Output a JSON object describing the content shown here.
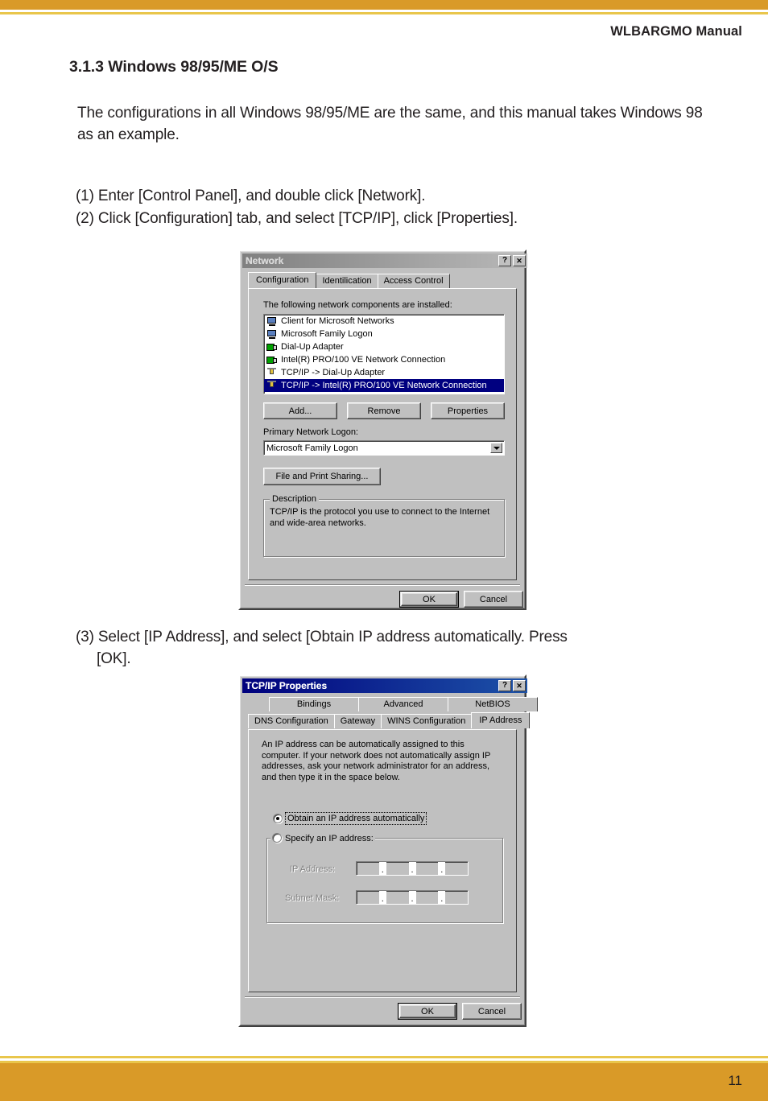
{
  "page": {
    "header_title": "WLBARGMO Manual",
    "page_number": "11",
    "accent_orange": "#d99a28",
    "accent_yellow": "#e9c64c"
  },
  "document": {
    "section_heading": "3.1.3 Windows 98/95/ME O/S",
    "intro_paragraph": "The configurations in all Windows 98/95/ME are the same, and this manual takes Windows 98 as an example.",
    "step1": "(1) Enter [Control Panel], and double click [Network].",
    "step2": "(2) Click [Configuration] tab, and select [TCP/IP], click [Properties].",
    "step3_line1": "(3) Select [IP Address], and select [Obtain IP address automatically. Press",
    "step3_line2": "[OK]."
  },
  "network_dialog": {
    "title": "Network",
    "titlebar_state": "inactive",
    "help_button": "?",
    "close_button": "✕",
    "tabs": [
      {
        "label": "Configuration",
        "selected": true
      },
      {
        "label": "Identilication",
        "selected": false
      },
      {
        "label": "Access Control",
        "selected": false
      }
    ],
    "list_label": "The following network components are installed:",
    "components": [
      {
        "label": "Client for Microsoft Networks",
        "icon": "monitor-icon",
        "selected": false
      },
      {
        "label": "Microsoft Family Logon",
        "icon": "monitor-icon",
        "selected": false
      },
      {
        "label": "Dial-Up Adapter",
        "icon": "network-card-icon",
        "selected": false
      },
      {
        "label": "Intel(R) PRO/100 VE Network Connection",
        "icon": "network-card-icon",
        "selected": false
      },
      {
        "label": "TCP/IP -> Dial-Up Adapter",
        "icon": "protocol-icon",
        "selected": false
      },
      {
        "label": "TCP/IP -> Intel(R) PRO/100 VE Network Connection",
        "icon": "protocol-icon",
        "selected": true
      }
    ],
    "add_button": "Add...",
    "remove_button": "Remove",
    "properties_button": "Properties",
    "primary_logon_label": "Primary Network Logon:",
    "primary_logon_value": "Microsoft Family Logon",
    "file_print_sharing_button": "File and Print Sharing...",
    "description_group_title": "Description",
    "description_text": "TCP/IP is the protocol you use to connect to the Internet and wide-area networks.",
    "ok_button": "OK",
    "cancel_button": "Cancel"
  },
  "tcpip_dialog": {
    "title": "TCP/IP Properties",
    "titlebar_state": "active",
    "help_button": "?",
    "close_button": "✕",
    "tabs_row1": [
      {
        "label": "Bindings",
        "selected": false
      },
      {
        "label": "Advanced",
        "selected": false
      },
      {
        "label": "NetBIOS",
        "selected": false
      }
    ],
    "tabs_row2": [
      {
        "label": "DNS Configuration",
        "selected": false
      },
      {
        "label": "Gateway",
        "selected": false
      },
      {
        "label": "WINS Configuration",
        "selected": false
      },
      {
        "label": "IP Address",
        "selected": true
      }
    ],
    "info_text": "An IP address can be automatically assigned to this computer. If your network does not automatically assign IP addresses, ask your network administrator for an address, and then type it in the space below.",
    "radio_obtain": {
      "label": "Obtain an IP address automatically",
      "selected": true,
      "focused": true
    },
    "radio_specify": {
      "label": "Specify an IP address:",
      "selected": false
    },
    "ip_address_label": "IP Address:",
    "ip_address_value": "",
    "subnet_mask_label": "Subnet Mask:",
    "subnet_mask_value": "",
    "fields_enabled": false,
    "ok_button": "OK",
    "cancel_button": "Cancel"
  }
}
